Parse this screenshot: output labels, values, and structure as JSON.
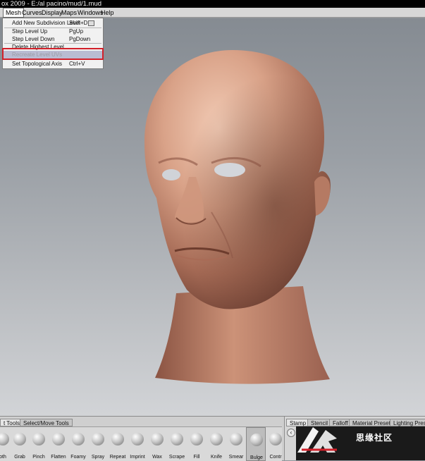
{
  "window": {
    "title": "ox 2009 - E:/al pacino/mud/1.mud"
  },
  "menubar": {
    "items": [
      "Mesh",
      "Curves",
      "Display",
      "Maps",
      "Windows",
      "Help"
    ]
  },
  "mesh_menu": {
    "items": [
      {
        "label": "Add New Subdivision Level",
        "shortcut": "Shift+D",
        "enabled": true
      },
      {
        "label": "Step Level Up",
        "shortcut": "PgUp",
        "enabled": true
      },
      {
        "label": "Step Level Down",
        "shortcut": "PgDown",
        "enabled": true
      },
      {
        "label": "Delete Highest Level",
        "shortcut": "",
        "enabled": true
      },
      {
        "label": "Recreate Level UVs",
        "shortcut": "",
        "enabled": false,
        "highlighted": true
      },
      {
        "label": "Set Topological Axis",
        "shortcut": "Ctrl+V",
        "enabled": true
      }
    ]
  },
  "tool_tabs": [
    "t Tools",
    "Select/Move Tools"
  ],
  "tools": [
    "oth",
    "Grab",
    "Pinch",
    "Flatten",
    "Foamy",
    "Spray",
    "Repeat",
    "Imprint",
    "Wax",
    "Scrape",
    "Fill",
    "Knife",
    "Smear",
    "Bulge",
    "Contr"
  ],
  "selected_tool": "Bulge",
  "right_tabs": [
    "Stamp",
    "Stencil",
    "Falloff",
    "Material Presets",
    "Lighting Presets"
  ],
  "colors": {
    "highlight": "#b9bcd2",
    "annotation_red": "#d2202a",
    "skin": "#c9927a"
  },
  "watermark": {
    "text": "思缘社区"
  }
}
